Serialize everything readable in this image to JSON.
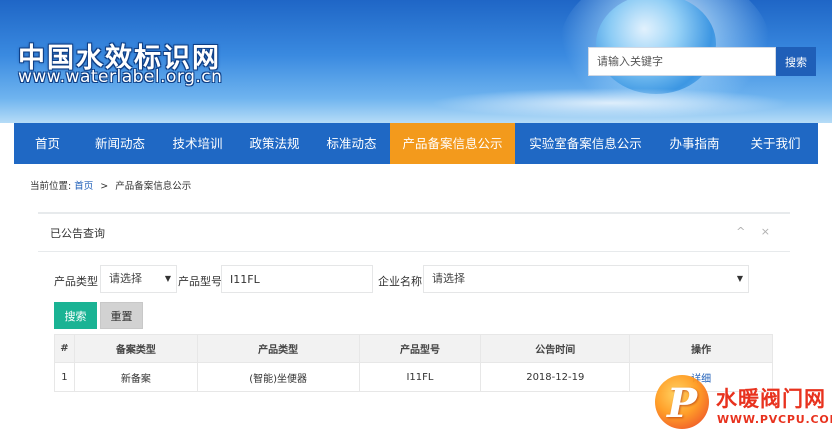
{
  "header": {
    "site_title": "中国水效标识网",
    "site_url": "www.waterlabel.org.cn",
    "search_placeholder": "请输入关键字",
    "search_button": "搜索"
  },
  "nav": {
    "items": [
      {
        "label": "首页"
      },
      {
        "label": "新闻动态"
      },
      {
        "label": "技术培训"
      },
      {
        "label": "政策法规"
      },
      {
        "label": "标准动态"
      },
      {
        "label": "产品备案信息公示"
      },
      {
        "label": "实验室备案信息公示"
      },
      {
        "label": "办事指南"
      },
      {
        "label": "关于我们"
      }
    ],
    "active": "产品备案信息公示"
  },
  "breadcrumb": {
    "prefix": "当前位置:",
    "home": "首页",
    "separator": ">",
    "current": "产品备案信息公示"
  },
  "panel": {
    "title": "已公告查询",
    "tools": "^ ×"
  },
  "filters": {
    "product_type_label": "产品类型",
    "product_type_value": "请选择",
    "product_model_label": "产品型号",
    "product_model_value": "I11FL",
    "company_label": "企业名称",
    "company_value": "请选择",
    "search_button": "搜索",
    "reset_button": "重置"
  },
  "table": {
    "headers": [
      "#",
      "备案类型",
      "产品类型",
      "产品型号",
      "公告时间",
      "操作"
    ],
    "rows": [
      {
        "index": "1",
        "filing_type": "新备案",
        "product_type": "(智能)坐便器",
        "model": "I11FL",
        "date": "2018-12-19",
        "action": "详细"
      }
    ]
  },
  "watermark": {
    "letter": "P",
    "name": "水暖阀门网",
    "url": "WWW.PVCPU.COM"
  },
  "colors": {
    "nav_bg": "#1f68c4",
    "nav_active": "#f39a1c",
    "search_btn": "#1f5fb8",
    "primary_btn": "#1ab394"
  }
}
